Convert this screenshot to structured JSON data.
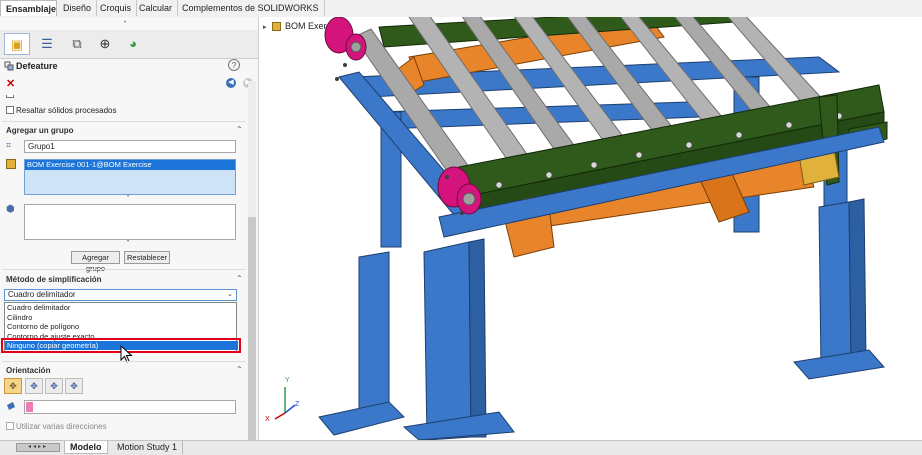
{
  "tabs": [
    "Ensamblaje",
    "Diseño",
    "Croquis",
    "Calcular",
    "Complementos de SOLIDWORKS"
  ],
  "panel": {
    "title": "Defeature",
    "options": {
      "highlight_label": "Resaltar sólidos procesados"
    },
    "group": {
      "heading": "Agregar un grupo",
      "group_name": "Grupo1",
      "component": "BOM Exercise 001-1@BOM Exercise",
      "add_button": "Agregar grupo",
      "reset_button": "Restablecer"
    },
    "simplification": {
      "heading": "Método de simplificación",
      "selected": "Cuadro delimitador",
      "options": [
        "Cuadro delimitador",
        "Cilindro",
        "Contorno de polígono",
        "Contorno de ajuste exacto",
        "Ninguno (copiar geometría)"
      ],
      "highlighted_option": "Ninguno (copiar geometría)"
    },
    "orientation": {
      "heading": "Orientación",
      "multi_direction_label": "Utilizar varias direcciones"
    }
  },
  "graphics": {
    "tree_item": "BOM Exercise",
    "triad": {
      "x": "X",
      "y": "Y",
      "z": "Z"
    },
    "colors": {
      "frame_blue": "#3b78c9",
      "rail_green": "#2f5a1c",
      "cylinder_orange": "#e8842a",
      "bearing_magenta": "#d4147c",
      "roller_grey": "#a9a9a9",
      "highlight_red": "#e3001b",
      "selection_blue": "#1d74d8"
    }
  },
  "bottom_tabs": [
    "Modelo",
    "Motion Study 1"
  ]
}
